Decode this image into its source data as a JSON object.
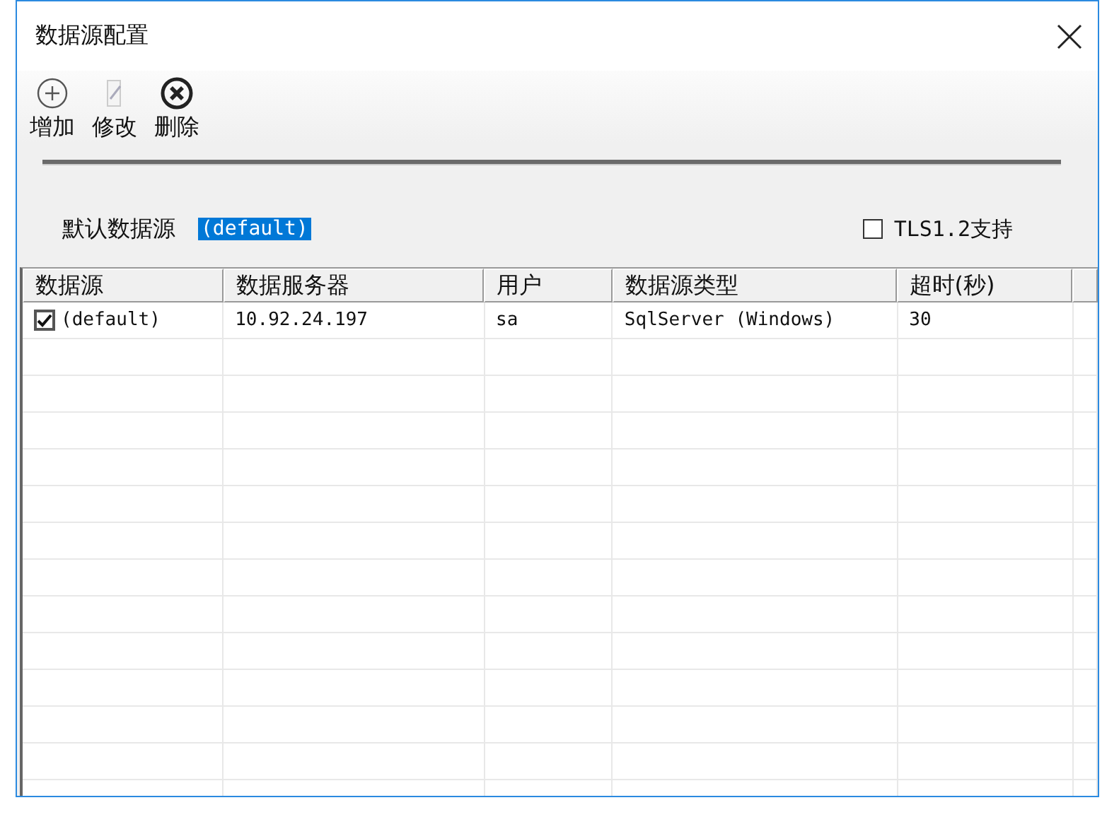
{
  "window": {
    "title": "数据源配置"
  },
  "toolbar": [
    {
      "label": "增加",
      "kind": "add"
    },
    {
      "label": "修改",
      "kind": "edit"
    },
    {
      "label": "删除",
      "kind": "delete"
    }
  ],
  "default_source": {
    "label": "默认数据源",
    "value": "(default)",
    "selected": true
  },
  "tls": {
    "label": "TLS1.2支持",
    "checked": false
  },
  "table": {
    "columns": [
      "数据源",
      "数据服务器",
      "用户",
      "数据源类型",
      "超时(秒)"
    ],
    "rows": [
      {
        "checked": true,
        "cells": [
          "(default)",
          "10.92.24.197",
          "sa",
          "SqlServer (Windows)",
          "30"
        ]
      }
    ]
  }
}
